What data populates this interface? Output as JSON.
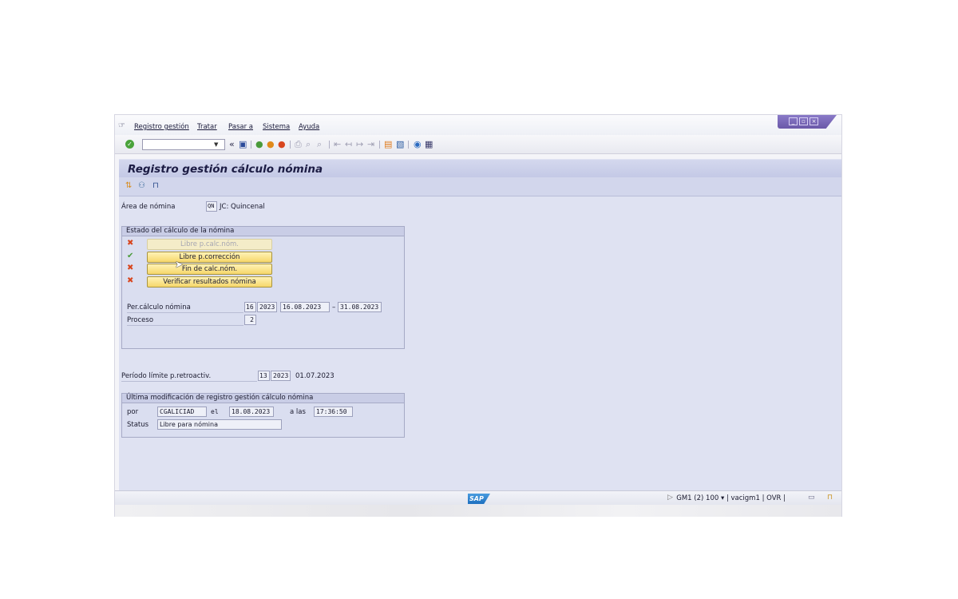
{
  "menu": {
    "items": [
      "Registro gestión",
      "Tratar",
      "Pasar a",
      "Sistema",
      "Ayuda"
    ]
  },
  "window_controls": [
    "minimize-icon",
    "restore-icon",
    "close-icon"
  ],
  "toolbar": {
    "command_field_value": "",
    "icons": [
      "enter-icon",
      "back-arrows-icon",
      "save-icon",
      "back-icon",
      "exit-icon",
      "cancel-icon",
      "print-icon",
      "find-icon",
      "find-next-icon",
      "first-page-icon",
      "prev-page-icon",
      "next-page-icon",
      "last-page-icon",
      "new-session-icon",
      "shortcut-icon",
      "help-icon",
      "customize-layout-icon"
    ]
  },
  "title": "Registro gestión cálculo nómina",
  "app_toolbar": {
    "icons": [
      "transport-icon",
      "users-icon",
      "lock-icon"
    ]
  },
  "area": {
    "label": "Área de nómina",
    "code": "QN",
    "description": "JC: Quincenal"
  },
  "estado": {
    "title": "Estado del cálculo de la nómina",
    "buttons": [
      {
        "label": "Libre p.calc.nóm.",
        "status": "error",
        "status_icon": "cross-icon",
        "enabled": false
      },
      {
        "label": "Libre p.corrección",
        "status": "ok",
        "status_icon": "check-icon",
        "enabled": true
      },
      {
        "label": "Fin de calc.nóm.",
        "status": "error",
        "status_icon": "cross-icon",
        "enabled": true
      },
      {
        "label": "Verificar resultados nómina",
        "status": "error",
        "status_icon": "cross-icon",
        "enabled": true
      }
    ],
    "per_calculo": {
      "label": "Per.cálculo nómina",
      "period": "16",
      "year": "2023",
      "start": "16.08.2023",
      "dash": "–",
      "end": "31.08.2023"
    },
    "proceso": {
      "label": "Proceso",
      "value": "2"
    }
  },
  "retro": {
    "label": "Período límite p.retroactiv.",
    "period": "13",
    "year": "2023",
    "date": "01.07.2023"
  },
  "ultima": {
    "title": "Última modificación de registro gestión cálculo nómina",
    "por_label": "por",
    "user": "CGALICIAD",
    "el_label": "el",
    "date": "18.08.2023",
    "a_las_label": "a las",
    "time": "17:36:50",
    "status_label": "Status",
    "status_value": "Libre para nómina"
  },
  "statusbar": {
    "logo": "SAP",
    "system": "GM1 (2) 100",
    "user": "vacigm1",
    "mode": "OVR"
  },
  "colors": {
    "title_bar": "#c4c9e6",
    "content_bg": "#dfe2f2",
    "button_yellow": "#f6d76a",
    "status_error": "#d8461e",
    "status_ok": "#4a9a3a",
    "window_controls": "#6a58a8"
  }
}
